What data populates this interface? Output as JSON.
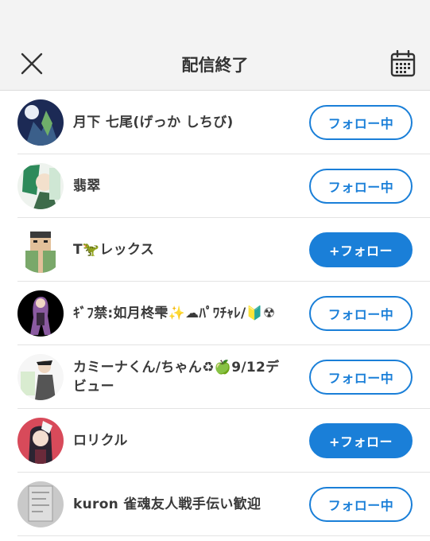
{
  "header": {
    "title": "配信終了",
    "close_icon": "close-icon",
    "calendar_icon": "calendar-icon"
  },
  "colors": {
    "accent": "#1a7fd8",
    "header_bg": "#f3f3f3",
    "divider": "#e3e3e3"
  },
  "users": [
    {
      "name": "月下 七尾(げっか しちび)",
      "button": "フォロー中",
      "following": true
    },
    {
      "name": "翡翠",
      "button": "フォロー中",
      "following": true
    },
    {
      "name": "T🦖レックス",
      "button": "+フォロー",
      "following": false
    },
    {
      "name": "ｷﾞﾌ禁:如月柊雫✨☁ﾊﾟﾜﾁｬﾚ/🔰☢",
      "button": "フォロー中",
      "following": true
    },
    {
      "name": "カミーナくん/ちゃん♻🍏9/12デビュー",
      "button": "フォロー中",
      "following": true
    },
    {
      "name": "ロリクル",
      "button": "+フォロー",
      "following": false
    },
    {
      "name": "kuron 雀魂友人戦手伝い歓迎",
      "button": "フォロー中",
      "following": true
    }
  ]
}
